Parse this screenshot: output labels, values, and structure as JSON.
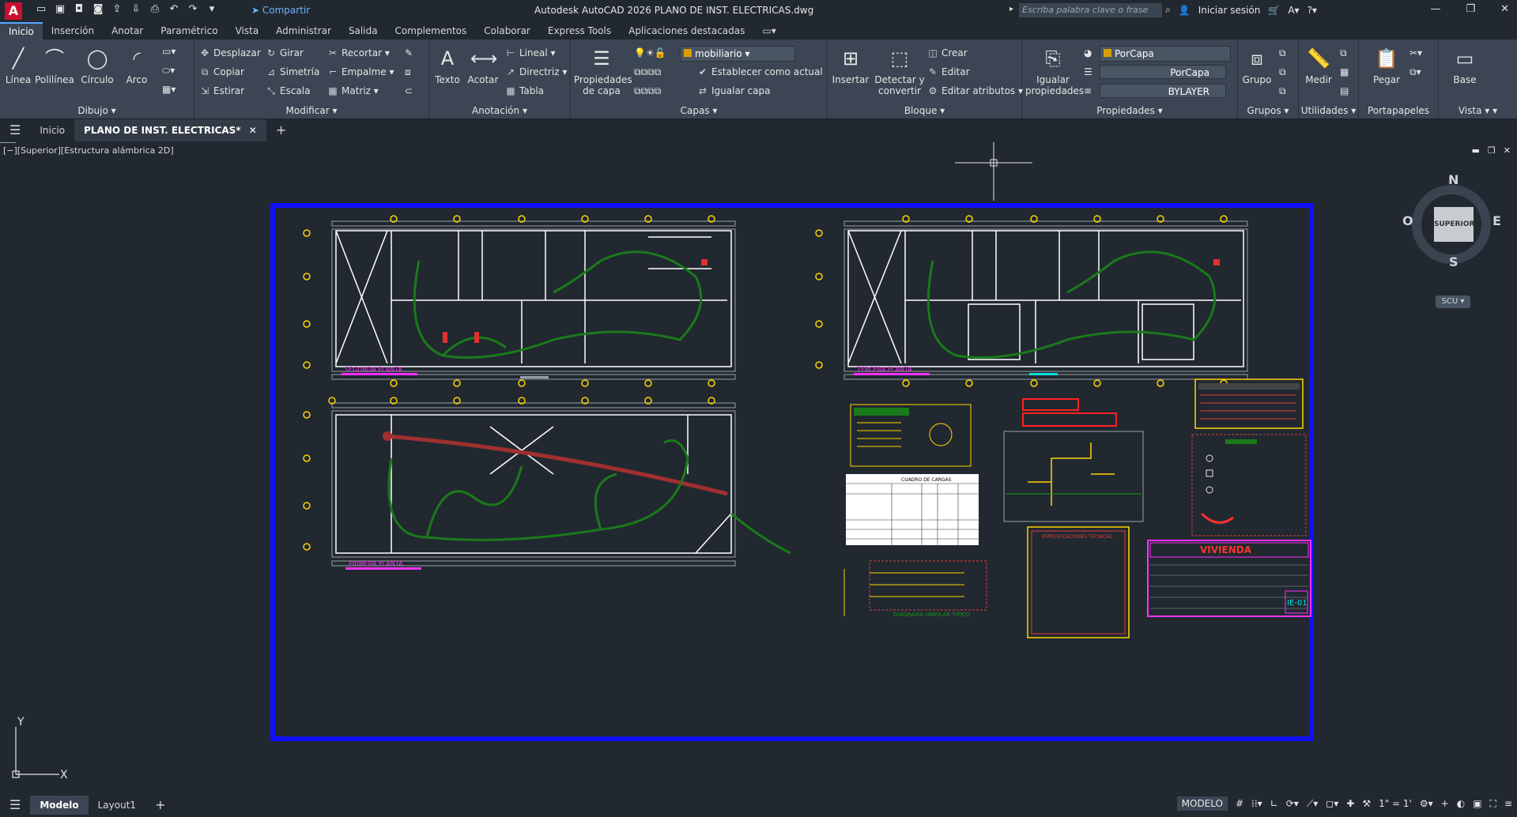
{
  "app": {
    "logo": "A",
    "share": "Compartir",
    "title": "Autodesk AutoCAD 2026    PLANO DE INST. ELECTRICAS.dwg",
    "search_placeholder": "Escriba palabra clave o frase",
    "signin": "Iniciar sesión"
  },
  "ribbon_tabs": [
    "Inicio",
    "Inserción",
    "Anotar",
    "Paramétrico",
    "Vista",
    "Administrar",
    "Salida",
    "Complementos",
    "Colaborar",
    "Express Tools",
    "Aplicaciones destacadas"
  ],
  "ribbon": {
    "dibujo": {
      "title": "Dibujo",
      "linea": "Línea",
      "polilinea": "Polilínea",
      "circulo": "Círculo",
      "arco": "Arco"
    },
    "modificar": {
      "title": "Modificar",
      "desplazar": "Desplazar",
      "girar": "Girar",
      "recortar": "Recortar",
      "copiar": "Copiar",
      "simetria": "Simetría",
      "empalme": "Empalme",
      "estirar": "Estirar",
      "escala": "Escala",
      "matriz": "Matriz"
    },
    "anotacion": {
      "title": "Anotación",
      "texto": "Texto",
      "acotar": "Acotar",
      "lineal": "Lineal",
      "directriz": "Directriz",
      "tabla": "Tabla"
    },
    "capas": {
      "title": "Capas",
      "propiedades": "Propiedades de capa",
      "layer_value": "mobiliario",
      "establecer": "Establecer como actual",
      "igualar": "Igualar capa"
    },
    "bloque": {
      "title": "Bloque",
      "insertar": "Insertar",
      "detectar": "Detectar y convertir",
      "crear": "Crear",
      "editar": "Editar",
      "editar_atributos": "Editar atributos"
    },
    "propiedades": {
      "title": "Propiedades",
      "igualar": "Igualar propiedades",
      "color": "PorCapa",
      "linetype": "PorCapa",
      "lineweight": "BYLAYER"
    },
    "grupos": {
      "title": "Grupos",
      "grupo": "Grupo"
    },
    "utilidades": {
      "title": "Utilidades",
      "medir": "Medir"
    },
    "portapapeles": {
      "title": "Portapapeles",
      "pegar": "Pegar"
    },
    "vista": {
      "title": "Vista",
      "base": "Base"
    }
  },
  "file_tabs": {
    "home": "Inicio",
    "active": "PLANO DE INST. ELECTRICAS*"
  },
  "viewport": {
    "label": "[−][Superior][Estructura alámbrica 2D]"
  },
  "viewcube": {
    "n": "N",
    "s": "S",
    "e": "E",
    "w": "O",
    "face": "SUPERIOR",
    "ucs": "SCU"
  },
  "drawing": {
    "plan_segunda": "SEGUNDA PLANTA",
    "plan_tercera": "TERCERA PLANTA",
    "plan_primera": "PRIMERA PLANTA",
    "cuadro_cargas": "CUADRO DE CARGAS",
    "diagrama_unifilar": "DIAGRAMA UNIFILAR TIPICO",
    "especificaciones": "ESPECIFICACIONES TECNICAS",
    "titulo_vivienda": "VIVIENDA",
    "lamina": "IE-01"
  },
  "axis": {
    "y": "Y",
    "x": "X"
  },
  "status": {
    "model_tab": "Modelo",
    "layout_tab": "Layout1",
    "model_btn": "MODELO",
    "scale": "1\" = 1'"
  },
  "colors": {
    "bg": "#212830",
    "ribbon": "#3b4553",
    "frame": "#1010ff",
    "accent": "#58a6ff"
  }
}
